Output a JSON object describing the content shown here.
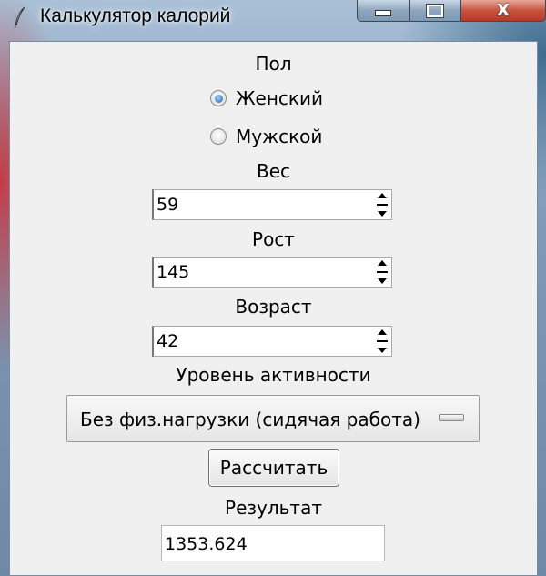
{
  "window": {
    "title": "Калькулятор калорий",
    "controls": {
      "minimize": "minimize",
      "maximize": "maximize",
      "close": "X"
    }
  },
  "form": {
    "gender": {
      "label": "Пол",
      "options": [
        {
          "label": "Женский",
          "selected": true
        },
        {
          "label": "Мужской",
          "selected": false
        }
      ]
    },
    "weight": {
      "label": "Вес",
      "value": "59"
    },
    "height": {
      "label": "Рост",
      "value": "145"
    },
    "age": {
      "label": "Возраст",
      "value": "42"
    },
    "activity": {
      "label": "Уровень активности",
      "selected": "Без физ.нагрузки (сидячая работа)"
    },
    "calculate_label": "Рассчитать",
    "result": {
      "label": "Результат",
      "value": "1353.624"
    }
  },
  "colors": {
    "client_bg": "#f0f0f0",
    "radio_accent": "#1c5fa8",
    "close_button": "#c8533f"
  }
}
